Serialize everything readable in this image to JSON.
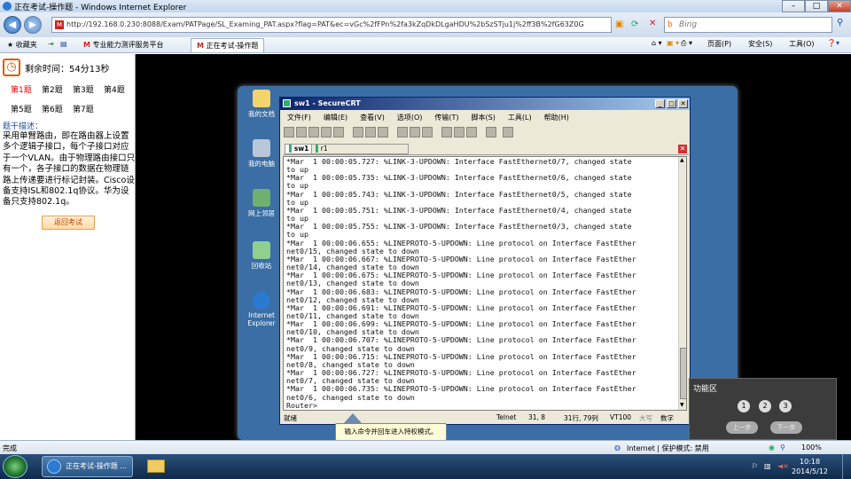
{
  "window": {
    "title": "正在考试-操作题 - Windows Internet Explorer"
  },
  "address": {
    "url": "http://192.168.0.230:8088/Exam/PATPage/SL_Examing_PAT.aspx?flag=PAT&ec=vGc%2fFPn%2fa3kZqDkDLgaHDU%2bSzSTju1j%2ff3B%2fG63Z0G"
  },
  "search": {
    "placeholder": "Bing"
  },
  "favbar": {
    "favorites": "收藏夹",
    "tab1": "专业能力测评服务平台",
    "tab2": "正在考试-操作题",
    "page": "页面(P)",
    "safety": "安全(S)",
    "tools": "工具(O)"
  },
  "exam": {
    "remaining": "剩余时间：54分13秒",
    "questions": [
      "第1题",
      "第2题",
      "第3题",
      "第4题",
      "第5题",
      "第6题",
      "第7题"
    ],
    "active_question": "第1题",
    "desc_title": "题干描述：",
    "desc": "采用单臂路由，即在路由器上设置多个逻辑子接口，每个子接口对应于一个VLAN。由于物理路由接口只有一个，各子接口的数据在物理链路上传递要进行标记封装。Cisco设备支持ISL和802.1q协议。华为设备只支持802.1q。",
    "return_button": "返回考试"
  },
  "desktop": {
    "icons": [
      "我的文档",
      "我的电脑",
      "网上邻居",
      "回收站",
      "Internet Explorer"
    ]
  },
  "securecrt": {
    "title": "sw1 - SecureCRT",
    "menu": [
      "文件(F)",
      "编辑(E)",
      "查看(V)",
      "选项(O)",
      "传输(T)",
      "脚本(S)",
      "工具(L)",
      "帮助(H)"
    ],
    "tabs": [
      "sw1",
      "r1"
    ],
    "terminal": "*Mar  1 00:00:05.727: %LINK-3-UPDOWN: Interface FastEthernet0/7, changed state\nto up\n*Mar  1 00:00:05.735: %LINK-3-UPDOWN: Interface FastEthernet0/6, changed state\nto up\n*Mar  1 00:00:05.743: %LINK-3-UPDOWN: Interface FastEthernet0/5, changed state\nto up\n*Mar  1 00:00:05.751: %LINK-3-UPDOWN: Interface FastEthernet0/4, changed state\nto up\n*Mar  1 00:00:05.755: %LINK-3-UPDOWN: Interface FastEthernet0/3, changed state\nto up\n*Mar  1 00:00:06.655: %LINEPROTO-5-UPDOWN: Line protocol on Interface FastEther\nnet0/15, changed state to down\n*Mar  1 00:00:06.667: %LINEPROTO-5-UPDOWN: Line protocol on Interface FastEther\nnet0/14, changed state to down\n*Mar  1 00:00:06.675: %LINEPROTO-5-UPDOWN: Line protocol on Interface FastEther\nnet0/13, changed state to down\n*Mar  1 00:00:06.683: %LINEPROTO-5-UPDOWN: Line protocol on Interface FastEther\nnet0/12, changed state to down\n*Mar  1 00:00:06.691: %LINEPROTO-5-UPDOWN: Line protocol on Interface FastEther\nnet0/11, changed state to down\n*Mar  1 00:00:06.699: %LINEPROTO-5-UPDOWN: Line protocol on Interface FastEther\nnet0/10, changed state to down\n*Mar  1 00:00:06.707: %LINEPROTO-5-UPDOWN: Line protocol on Interface FastEther\nnet0/9, changed state to down\n*Mar  1 00:00:06.715: %LINEPROTO-5-UPDOWN: Line protocol on Interface FastEther\nnet0/8, changed state to down\n*Mar  1 00:00:06.727: %LINEPROTO-5-UPDOWN: Line protocol on Interface FastEther\nnet0/7, changed state to down\n*Mar  1 00:00:06.735: %LINEPROTO-5-UPDOWN: Line protocol on Interface FastEther\nnet0/6, changed state to down\nRouter>",
    "status": {
      "ready": "就绪",
      "proto": "Telnet",
      "pos": "31,  8",
      "rowcol": "31行, 79列",
      "term": "VT100",
      "caps": "大写",
      "num": "数字"
    }
  },
  "tooltip": "输入命令并回车进入特权模式。",
  "func": {
    "title": "功能区",
    "nums": [
      "1",
      "2",
      "3"
    ],
    "buttons": [
      "上一步",
      "下一步"
    ]
  },
  "iestatus": {
    "done": "完成",
    "zone": "Internet | 保护模式: 禁用",
    "zoom": "100%"
  },
  "taskbar": {
    "ie": "正在考试-操作题 ...",
    "time": "10:18",
    "date": "2014/5/12"
  }
}
